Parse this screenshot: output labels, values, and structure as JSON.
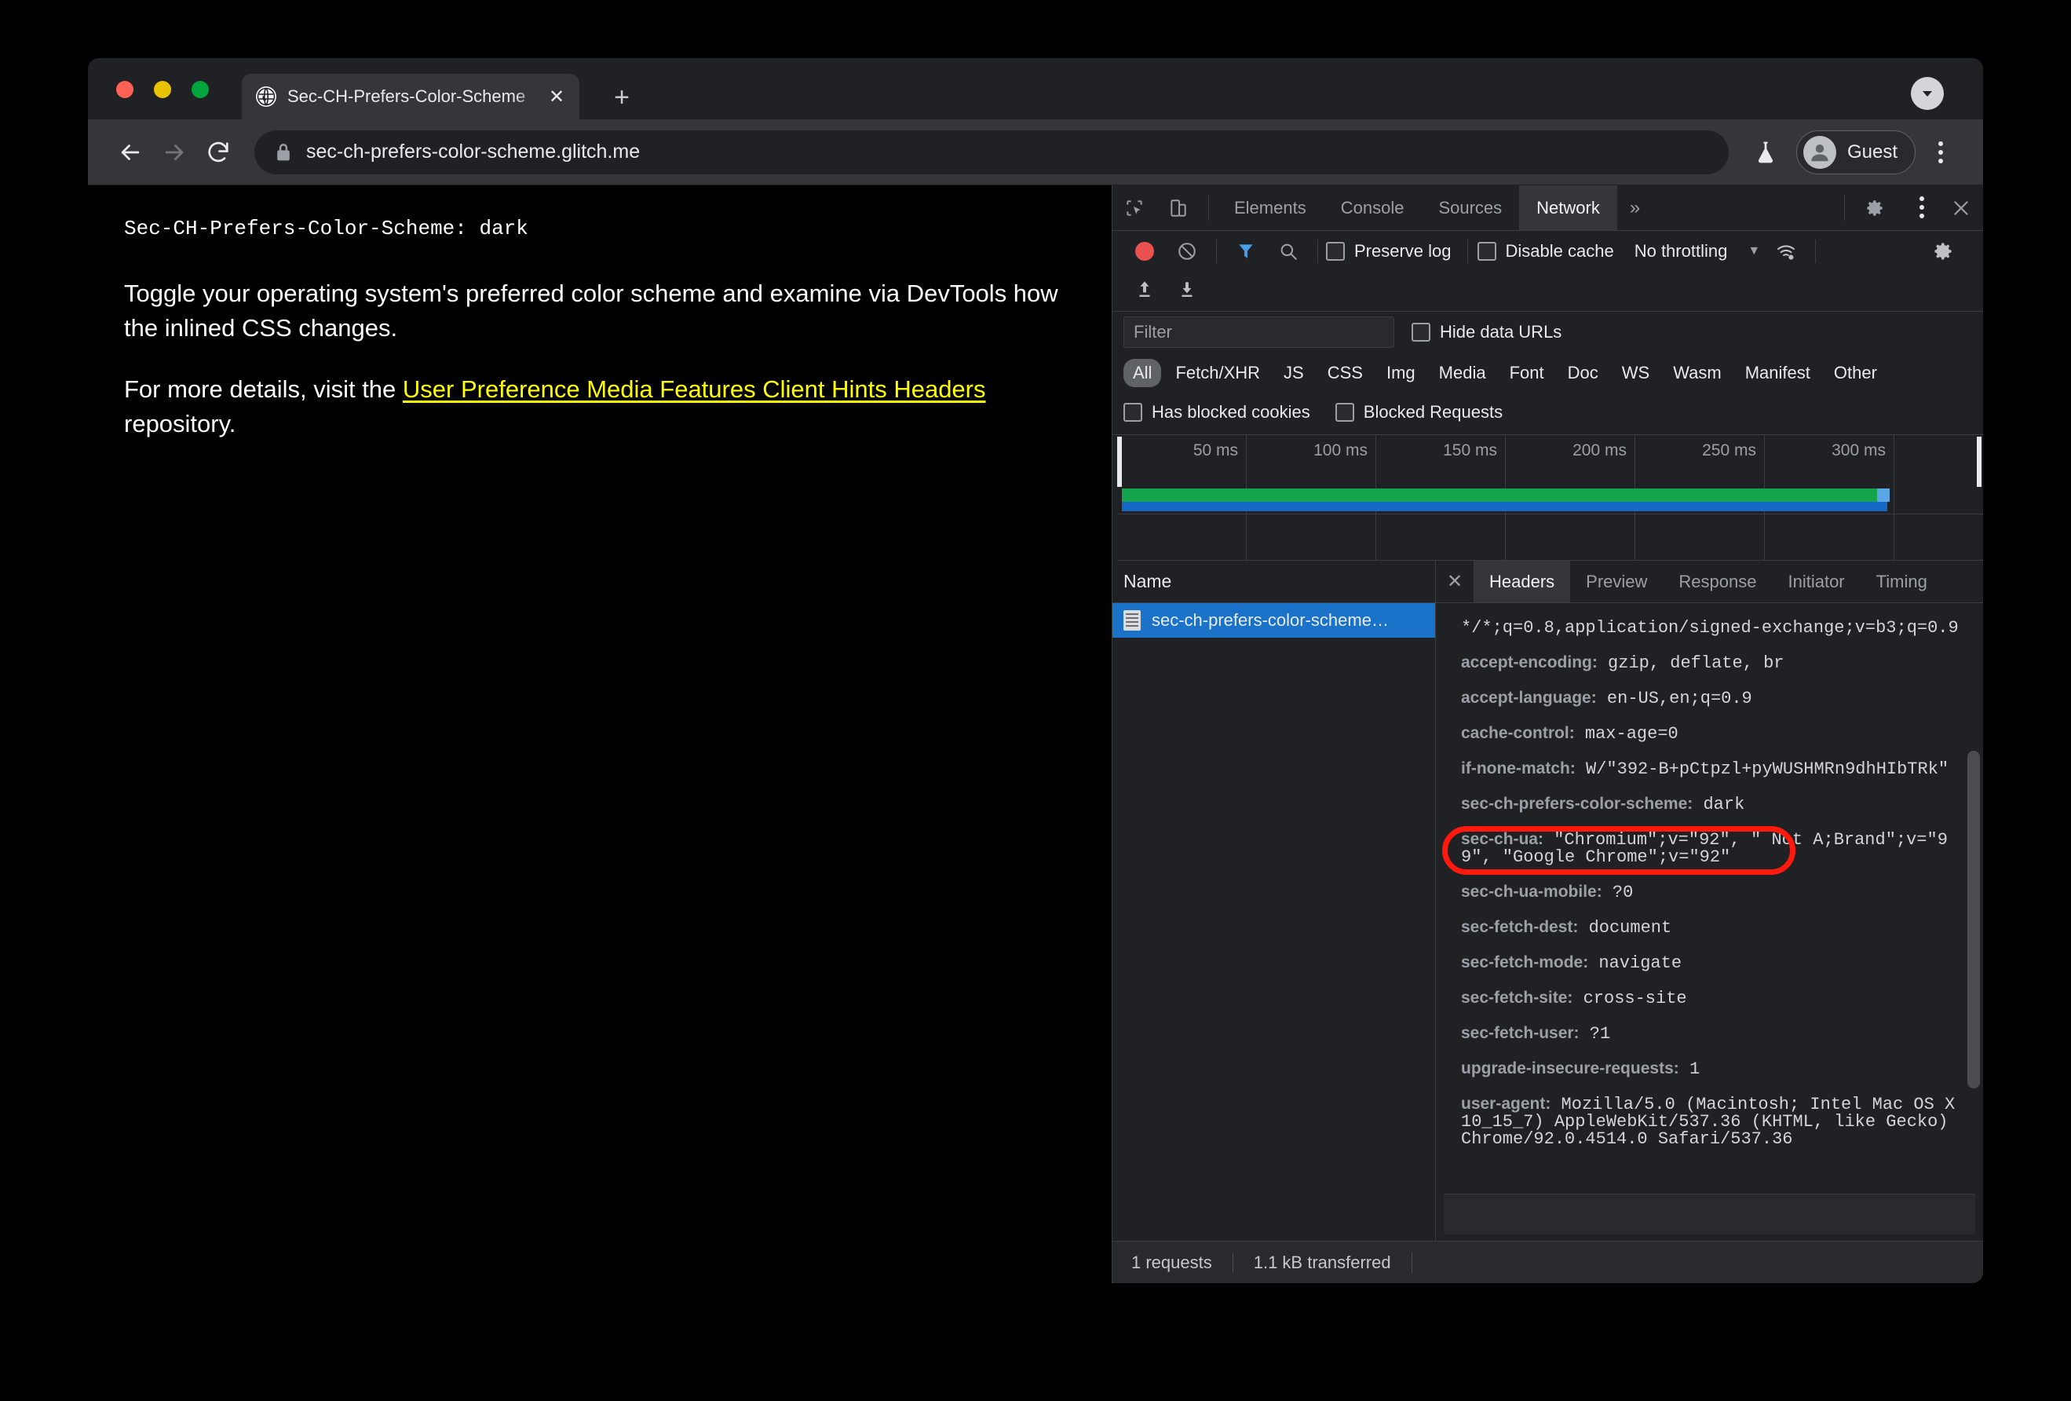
{
  "browser": {
    "tab": {
      "title": "Sec-CH-Prefers-Color-Scheme",
      "close_label": "✕",
      "favicon": "globe-icon"
    },
    "newtab_label": "+",
    "tab_chevron": "▼",
    "toolbar": {
      "back": "←",
      "forward": "→",
      "reload": "⟳",
      "lock": "lock-icon",
      "url": "sec-ch-prefers-color-scheme.glitch.me",
      "experiments": "flask-icon",
      "profile": "Guest",
      "menu": "kebab-menu-icon"
    }
  },
  "page": {
    "header_line": "Sec-CH-Prefers-Color-Scheme: dark",
    "paragraph1": "Toggle your operating system's preferred color scheme and examine via DevTools how the inlined CSS changes.",
    "paragraph2_before": "For more details, visit the ",
    "link_text": "User Preference Media Features Client Hints Headers",
    "paragraph2_after": " repository."
  },
  "devtools": {
    "inspect_icon": "inspect-element-icon",
    "device_icon": "device-toolbar-icon",
    "tabs": [
      {
        "label": "Elements",
        "active": false
      },
      {
        "label": "Console",
        "active": false
      },
      {
        "label": "Sources",
        "active": false
      },
      {
        "label": "Network",
        "active": true
      }
    ],
    "more_tabs": "»",
    "settings_icon": "gear-icon",
    "dock_icon": "kebab-menu-icon",
    "close_icon": "close-icon",
    "network_toolbar": {
      "record": "record-button",
      "clear": "clear-icon",
      "filter_icon": "filter-icon",
      "search_icon": "search-icon",
      "preserve_log": "Preserve log",
      "disable_cache": "Disable cache",
      "throttling": "No throttling",
      "throttle_caret": "▼",
      "network_conditions": "wifi-settings-icon",
      "capture_settings": "gear-icon",
      "import_har": "import-har-icon",
      "export_har": "export-har-icon"
    },
    "filter_bar": {
      "filter_placeholder": "Filter",
      "hide_data_urls": "Hide data URLs",
      "types": [
        "All",
        "Fetch/XHR",
        "JS",
        "CSS",
        "Img",
        "Media",
        "Font",
        "Doc",
        "WS",
        "Wasm",
        "Manifest",
        "Other"
      ],
      "active_type": "All",
      "has_blocked_cookies": "Has blocked cookies",
      "blocked_requests": "Blocked Requests"
    },
    "overview": {
      "ticks": [
        "50 ms",
        "100 ms",
        "150 ms",
        "200 ms",
        "250 ms",
        "300 ms"
      ],
      "bar_green": "#14a44b",
      "bar_blue": "#1668c7"
    },
    "request_list": {
      "column_name": "Name",
      "rows": [
        {
          "name": "sec-ch-prefers-color-scheme…",
          "selected": true,
          "icon": "document-icon"
        }
      ]
    },
    "detail": {
      "close": "✕",
      "tabs": [
        {
          "label": "Headers",
          "active": true
        },
        {
          "label": "Preview",
          "active": false
        },
        {
          "label": "Response",
          "active": false
        },
        {
          "label": "Initiator",
          "active": false
        },
        {
          "label": "Timing",
          "active": false
        }
      ],
      "headers": [
        {
          "name": "",
          "value": "*/*;q=0.8,application/signed-exchange;v=b3;q=0.9"
        },
        {
          "name": "accept-encoding:",
          "value": " gzip, deflate, br"
        },
        {
          "name": "accept-language:",
          "value": " en-US,en;q=0.9"
        },
        {
          "name": "cache-control:",
          "value": " max-age=0"
        },
        {
          "name": "if-none-match:",
          "value": " W/\"392-B+pCtpzl+pyWUSHMRn9dhHIbTRk\""
        },
        {
          "name": "sec-ch-prefers-color-scheme:",
          "value": " dark",
          "highlighted": true
        },
        {
          "name": "sec-ch-ua:",
          "value": " \"Chromium\";v=\"92\", \" Not A;Brand\";v=\"99\", \"Google Chrome\";v=\"92\""
        },
        {
          "name": "sec-ch-ua-mobile:",
          "value": " ?0"
        },
        {
          "name": "sec-fetch-dest:",
          "value": " document"
        },
        {
          "name": "sec-fetch-mode:",
          "value": " navigate"
        },
        {
          "name": "sec-fetch-site:",
          "value": " cross-site"
        },
        {
          "name": "sec-fetch-user:",
          "value": " ?1"
        },
        {
          "name": "upgrade-insecure-requests:",
          "value": " 1"
        },
        {
          "name": "user-agent:",
          "value": " Mozilla/5.0 (Macintosh; Intel Mac OS X 10_15_7) AppleWebKit/537.36 (KHTML, like Gecko) Chrome/92.0.4514.0 Safari/537.36"
        }
      ]
    },
    "status_bar": {
      "requests": "1 requests",
      "transferred": "1.1 kB transferred"
    },
    "annotation": {
      "color": "#ff1a0d",
      "target": "sec-ch-prefers-color-scheme: dark"
    }
  }
}
